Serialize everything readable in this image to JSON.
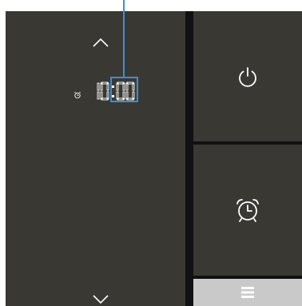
{
  "clock": {
    "hour_digits": [
      "1",
      "0"
    ],
    "minute_digits": [
      "0",
      "0"
    ]
  },
  "colors": {
    "panel": "#3a3833",
    "divider": "#111111",
    "highlight": "#3a8fd6",
    "menu_button": "#c9c9c9",
    "foreground": "#ffffff"
  },
  "icons": {
    "up": "chevron-up-icon",
    "down": "chevron-down-icon",
    "alarm_small": "alarm-clock-icon",
    "power": "power-icon",
    "alarm": "alarm-clock-icon",
    "menu": "menu-icon"
  }
}
